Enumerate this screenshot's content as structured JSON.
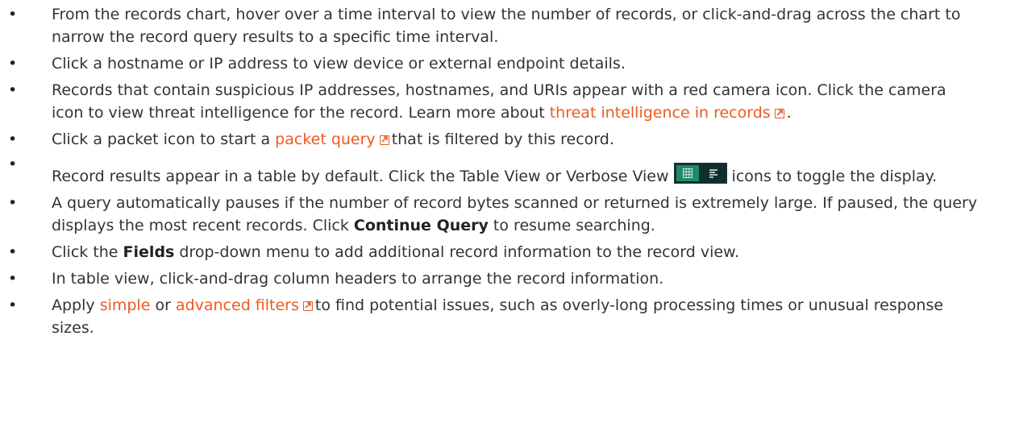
{
  "bullets": [
    {
      "text": "From the records chart, hover over a time interval to view the number of records, or click-and-drag across the chart to narrow the record query results to a specific time interval."
    },
    {
      "text": "Click a hostname or IP address to view device or external endpoint details."
    },
    {
      "text_before": "Records that contain suspicious IP addresses, hostnames, and URIs appear with a red camera icon. Click the camera icon to view threat intelligence for the record. Learn more about ",
      "link": "threat intelligence in records",
      "text_after": "."
    },
    {
      "text_before": "Click a packet icon to start a ",
      "link": "packet query",
      "text_after": "that is filtered by this record."
    },
    {
      "text_before": "Record results appear in a table by default. Click the Table View or Verbose View",
      "text_after": "icons to toggle the display."
    },
    {
      "text_before": "A query automatically pauses if the number of record bytes scanned or returned is extremely large. If paused, the query displays the most recent records. Click ",
      "bold": "Continue Query",
      "text_after": " to resume searching."
    },
    {
      "text_before": "Click the ",
      "bold": "Fields",
      "text_after": " drop-down menu to add additional record information to the record view."
    },
    {
      "text": "In table view, click-and-drag column headers to arrange the record information."
    },
    {
      "text_before": "Apply ",
      "link1": "simple",
      "text_middle": " or ",
      "link2": "advanced filters",
      "text_after": "to find potential issues, such as overly-long processing times or unusual response sizes."
    }
  ],
  "bullet_glyph": "•",
  "colors": {
    "link": "#ec5b1d",
    "text": "#333333",
    "toggle_bg": "#0f2e2d",
    "toggle_active": "#1e8a68"
  },
  "icons": {
    "external_link": "external-link-icon",
    "table_view": "table-view-icon",
    "verbose_view": "verbose-view-icon"
  }
}
